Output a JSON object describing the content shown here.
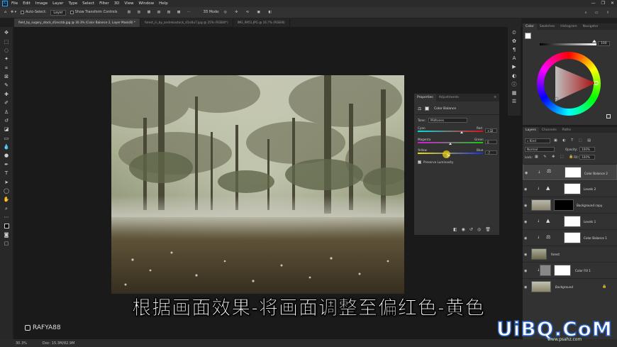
{
  "menubar": {
    "logo": "Ps",
    "items": [
      "File",
      "Edit",
      "Image",
      "Layer",
      "Type",
      "Select",
      "Filter",
      "3D",
      "View",
      "Window",
      "Help"
    ]
  },
  "options": {
    "auto_select_label": "Auto-Select:",
    "auto_select_value": "Layer",
    "transform_controls_label": "Show Transform Controls",
    "mode_3d": "3D Mode:"
  },
  "tabs": [
    "field_by_sugary_stock_d1ecckb.jpg @ 30.3% (Color Balance 2, Layer Mask/8) *",
    "forest_iii_by_andrekastock_d1sl4u7.jpg @ 25% (RGB/8*)",
    "IMG_9951.JPG @ 16.7% (RGB/8)"
  ],
  "color_panel": {
    "tabs": [
      "Color",
      "Swatches",
      "Histogram",
      "Navigator"
    ],
    "brightness_value": "100"
  },
  "layers_panel": {
    "tabs": [
      "Layers",
      "Channels",
      "Paths"
    ],
    "kind_label": "Kind",
    "blend_mode": "Normal",
    "opacity_label": "Opacity:",
    "opacity_value": "100%",
    "lock_label": "Lock:",
    "fill_label": "Fill:",
    "fill_value": "100%",
    "layers": [
      {
        "name": "Color Balance 2",
        "selected": true
      },
      {
        "name": "Levels 2",
        "selected": false
      },
      {
        "name": "Background copy",
        "selected": false
      },
      {
        "name": "Levels 1",
        "selected": false
      },
      {
        "name": "Color Balance 1",
        "selected": false
      },
      {
        "name": "forest",
        "selected": false
      },
      {
        "name": "Color Fill 1",
        "selected": false
      },
      {
        "name": "Background",
        "selected": false
      }
    ]
  },
  "properties_panel": {
    "tabs": [
      "Properties",
      "Adjustments"
    ],
    "title": "Color Balance",
    "tone_label": "Tone:",
    "tone_value": "Midtones",
    "sliders": [
      {
        "left": "Cyan",
        "right": "Red",
        "value": "+32",
        "position": 0.67
      },
      {
        "left": "Magenta",
        "right": "Green",
        "value": "0",
        "position": 0.5
      },
      {
        "left": "Yellow",
        "right": "Blue",
        "value": "-7",
        "position": 0.46
      }
    ],
    "preserve_luminosity_label": "Preserve Luminosity",
    "preserve_luminosity": true
  },
  "status": {
    "zoom": "30.3%",
    "doc": "Doc: 15.3M/82.9M"
  },
  "subtitle": "根据画面效果-将画面调整至偏红色-黄色",
  "watermark": "RAFYA88",
  "site_logo": "UiBQ.CoM",
  "site_url": "www.psahz.com",
  "colors": {
    "ui_dark": "#323232",
    "accent_blue": "#31a8ff",
    "logo_blue": "#2a63c8"
  }
}
